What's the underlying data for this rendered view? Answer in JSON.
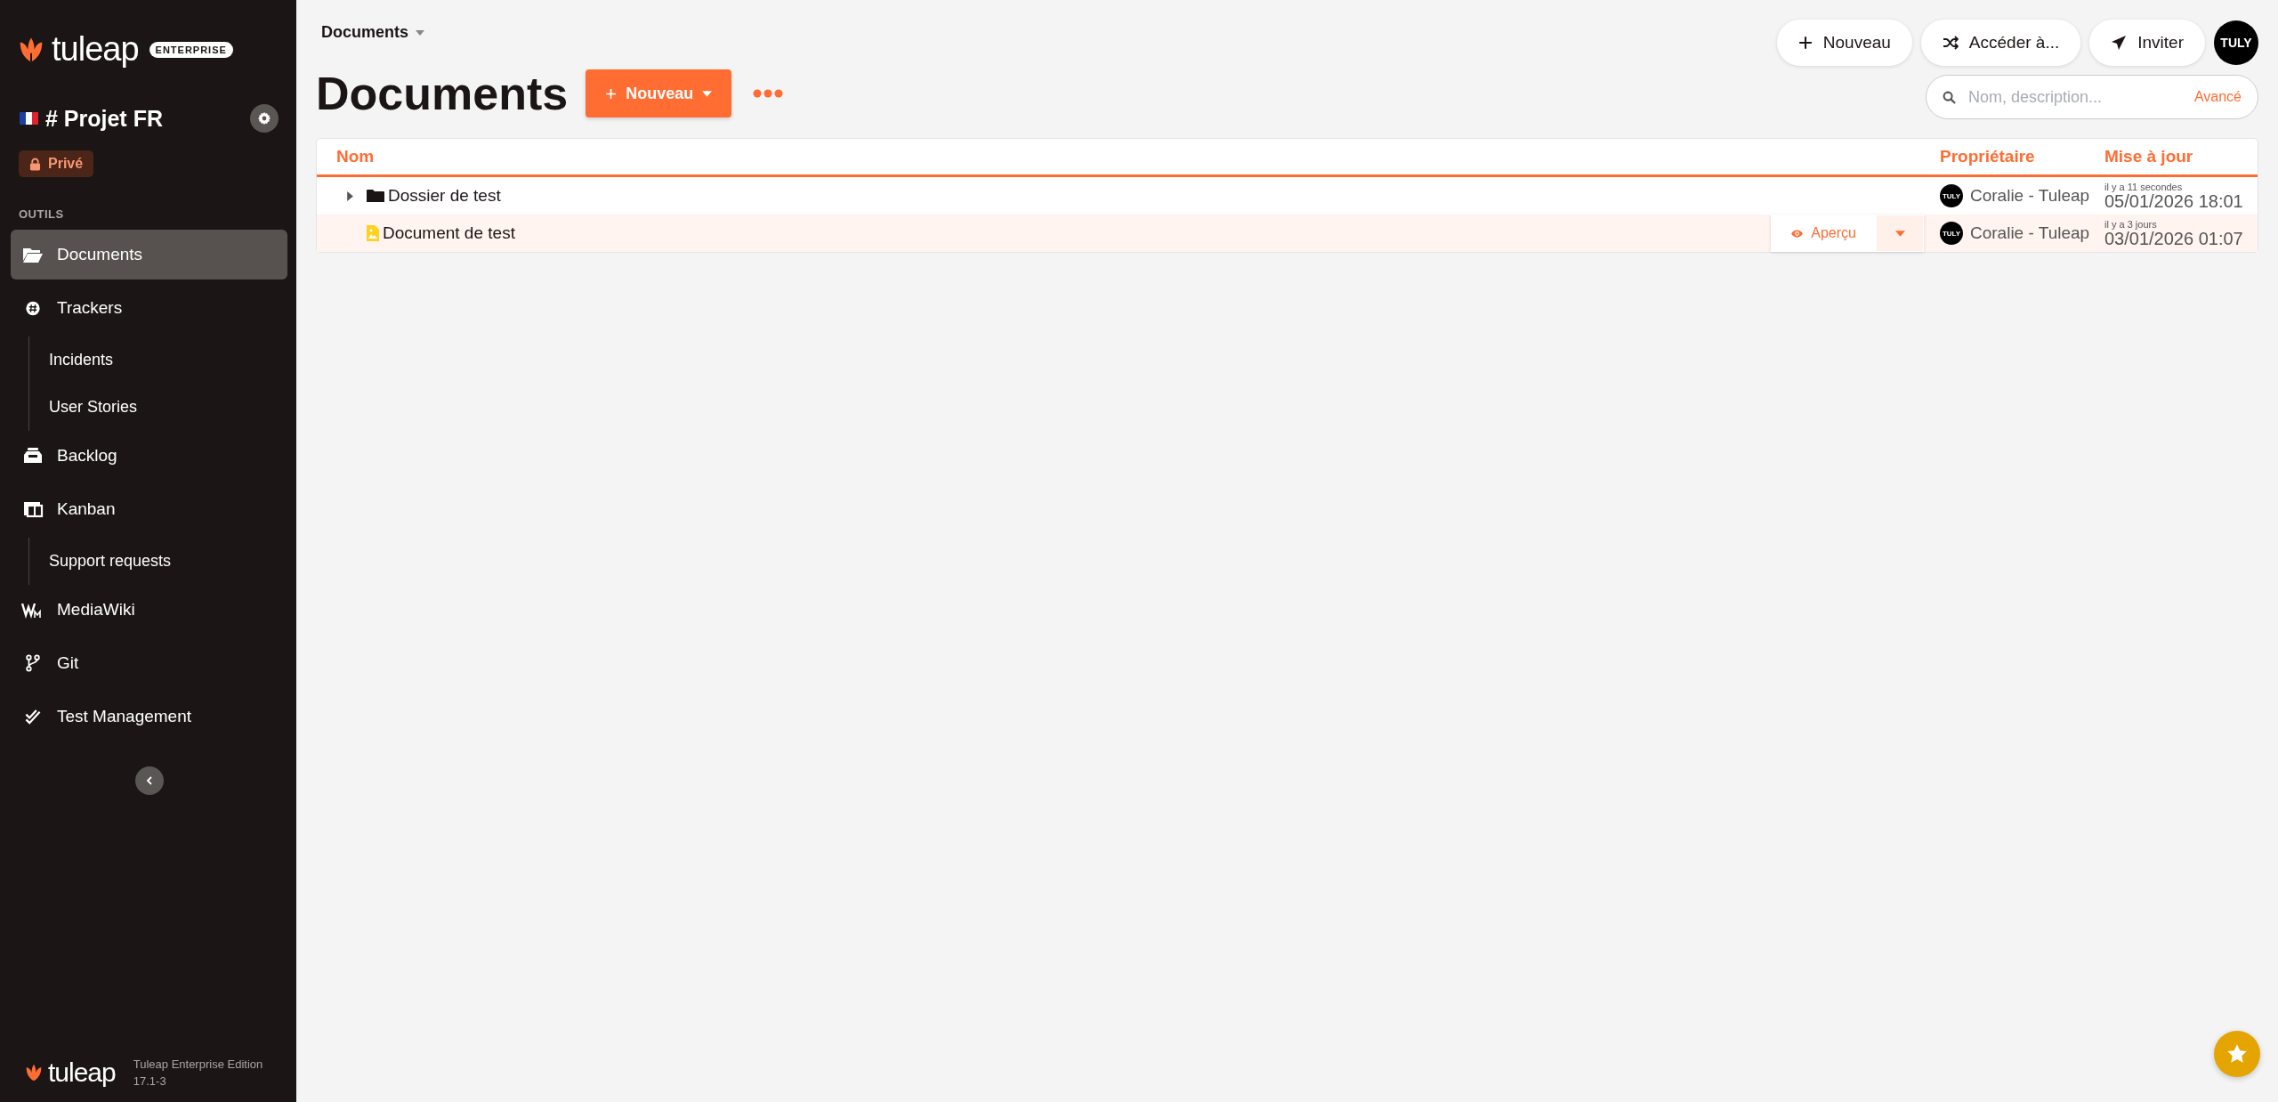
{
  "sidebar": {
    "logo": {
      "name": "tuleap",
      "badge": "ENTERPRISE"
    },
    "project": {
      "title": "# Projet FR",
      "visibility": "Privé"
    },
    "section": "OUTILS",
    "items": [
      {
        "kind": "documents",
        "label": "Documents",
        "selected": true
      },
      {
        "kind": "trackers",
        "label": "Trackers",
        "selected": false,
        "children": [
          {
            "label": "Incidents",
            "selected": false
          },
          {
            "label": "User Stories",
            "selected": false
          }
        ]
      },
      {
        "kind": "backlog",
        "label": "Backlog",
        "selected": false
      },
      {
        "kind": "kanban",
        "label": "Kanban",
        "selected": false,
        "children": [
          {
            "label": "Support requests",
            "selected": false
          }
        ]
      },
      {
        "kind": "mediawiki",
        "label": "MediaWiki",
        "selected": false
      },
      {
        "kind": "git",
        "label": "Git",
        "selected": false
      },
      {
        "kind": "testmgmt",
        "label": "Test Management",
        "selected": false
      }
    ],
    "footer": {
      "logo": "tuleap",
      "edition": "Tuleap Enterprise Edition",
      "version": "17.1-3"
    }
  },
  "topbar": {
    "breadcrumb": "Documents",
    "buttons": [
      {
        "kind": "new",
        "label": "Nouveau"
      },
      {
        "kind": "switch",
        "label": "Accéder à..."
      },
      {
        "kind": "invite",
        "label": "Inviter"
      }
    ],
    "avatar": "TULY"
  },
  "header": {
    "title": "Documents",
    "new_button": "Nouveau"
  },
  "search": {
    "placeholder": "Nom, description...",
    "advanced": "Avancé"
  },
  "table": {
    "columns": [
      "Nom",
      "Propriétaire",
      "Mise à jour"
    ],
    "rows": [
      {
        "kind": "folder",
        "name": "Dossier de test",
        "expanded": false,
        "selected": false,
        "owner": {
          "avatar": "TULY",
          "name": "Coralie - Tuleap"
        },
        "relative": "il y a 11 secondes",
        "date": "05/01/2026 18:01"
      },
      {
        "kind": "document",
        "name": "Document de test",
        "selected": true,
        "preview": "Aperçu",
        "owner": {
          "avatar": "TULY",
          "name": "Coralie - Tuleap"
        },
        "relative": "il y a 3 jours",
        "date": "03/01/2026 01:07"
      }
    ]
  }
}
